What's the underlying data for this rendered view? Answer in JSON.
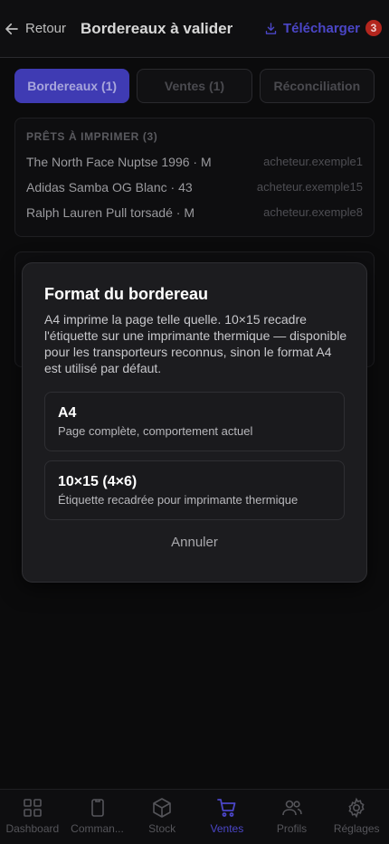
{
  "header": {
    "back_label": "Retour",
    "title": "Bordereaux à valider",
    "download_label": "Télécharger",
    "download_count": "3"
  },
  "tabs": [
    {
      "label": "Bordereaux (1)"
    },
    {
      "label": "Ventes (1)"
    },
    {
      "label": "Réconciliation"
    }
  ],
  "ready": {
    "title": "PRÊTS À IMPRIMER (3)",
    "items": [
      {
        "name": "The North Face Nuptse 1996 · M",
        "buyer": "acheteur.exemple1"
      },
      {
        "name": "Adidas Samba OG Blanc · 43",
        "buyer": "acheteur.exemple15"
      },
      {
        "name": "Ralph Lauren Pull torsadé · M",
        "buyer": "acheteur.exemple8"
      }
    ]
  },
  "modal": {
    "title": "Format du bordereau",
    "description": "A4 imprime la page telle quelle. 10×15 recadre l'étiquette sur une imprimante thermique — disponible pour les transporteurs reconnus, sinon le format A4 est utilisé par défaut.",
    "options": [
      {
        "name": "A4",
        "desc": "Page complète, comportement actuel"
      },
      {
        "name": "10×15 (4×6)",
        "desc": "Étiquette recadrée pour imprimante thermique"
      }
    ],
    "cancel": "Annuler"
  },
  "nav": [
    {
      "label": "Dashboard",
      "icon": "dashboard-icon"
    },
    {
      "label": "Comman...",
      "icon": "orders-icon"
    },
    {
      "label": "Stock",
      "icon": "box-icon"
    },
    {
      "label": "Ventes",
      "icon": "cart-icon",
      "active": true
    },
    {
      "label": "Profils",
      "icon": "users-icon"
    },
    {
      "label": "Réglages",
      "icon": "gear-icon"
    }
  ]
}
